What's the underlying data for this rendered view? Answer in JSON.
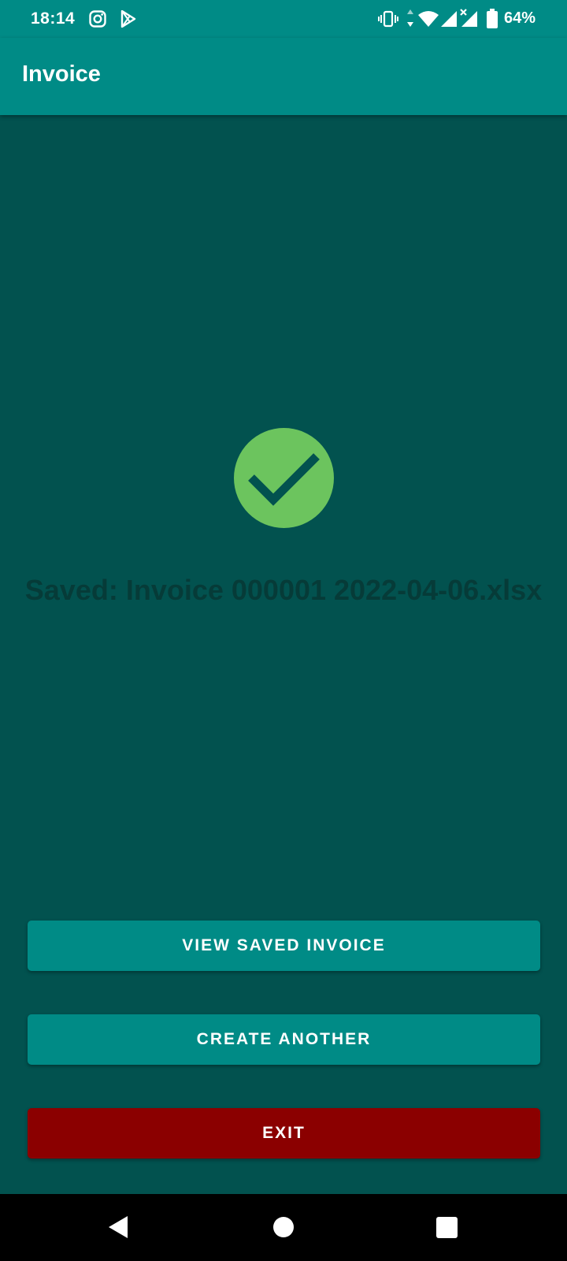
{
  "status_bar": {
    "time": "18:14",
    "battery_percent": "64%",
    "left_icons": [
      "instagram-icon",
      "play-store-icon"
    ],
    "right_icons": [
      "vibrate-icon",
      "data-arrows-icon",
      "wifi-icon",
      "signal-icon",
      "signal-no-data-icon",
      "battery-icon"
    ]
  },
  "app_bar": {
    "title": "Invoice"
  },
  "main": {
    "status_icon": "check-circle-icon",
    "saved_message": "Saved: Invoice 000001 2022-04-06.xlsx"
  },
  "buttons": {
    "view_saved": "VIEW SAVED INVOICE",
    "create_another": "CREATE ANOTHER",
    "exit": "EXIT"
  },
  "nav_bar": {
    "icons": [
      "back-icon",
      "home-icon",
      "recents-icon"
    ]
  },
  "colors": {
    "primary": "#008b86",
    "background": "#02524f",
    "success": "#6cc45e",
    "danger": "#8b0000",
    "nav_background": "#000000"
  }
}
